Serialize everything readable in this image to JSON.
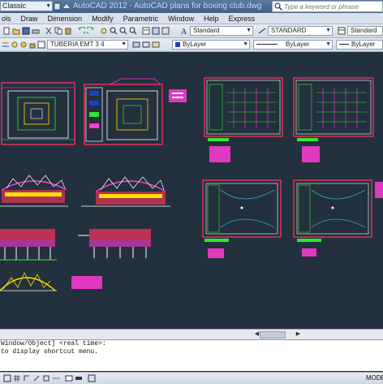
{
  "window": {
    "workspace": "Classic",
    "app_title": "AutoCAD 2012 - AutoCAD plans for boxing club.dwg",
    "search_placeholder": "Type a keyword or phrase"
  },
  "menu": [
    "ols",
    "Draw",
    "Dimension",
    "Modify",
    "Parametric",
    "Window",
    "Help",
    "Express"
  ],
  "toolbar": {
    "text_style": "Standard",
    "dim_style": "STANDARD",
    "table_style": "Standard",
    "layer": "TUBERIA EMT 3 4",
    "color": "ByLayer",
    "linetype": "ByLayer",
    "lineweight": "ByLayer"
  },
  "command_line": {
    "line1": "Window/Object] <real time>:",
    "line2": "to display shortcut menu."
  },
  "status": {
    "model": "MODE"
  },
  "colors": {
    "canvas": "#23303d",
    "frame": "#e0335a",
    "white_line": "#ffffff",
    "accent_magenta": "#ff3bd6",
    "accent_green": "#33e633",
    "accent_yellow": "#ffe000",
    "accent_cyan": "#33e6ff"
  }
}
